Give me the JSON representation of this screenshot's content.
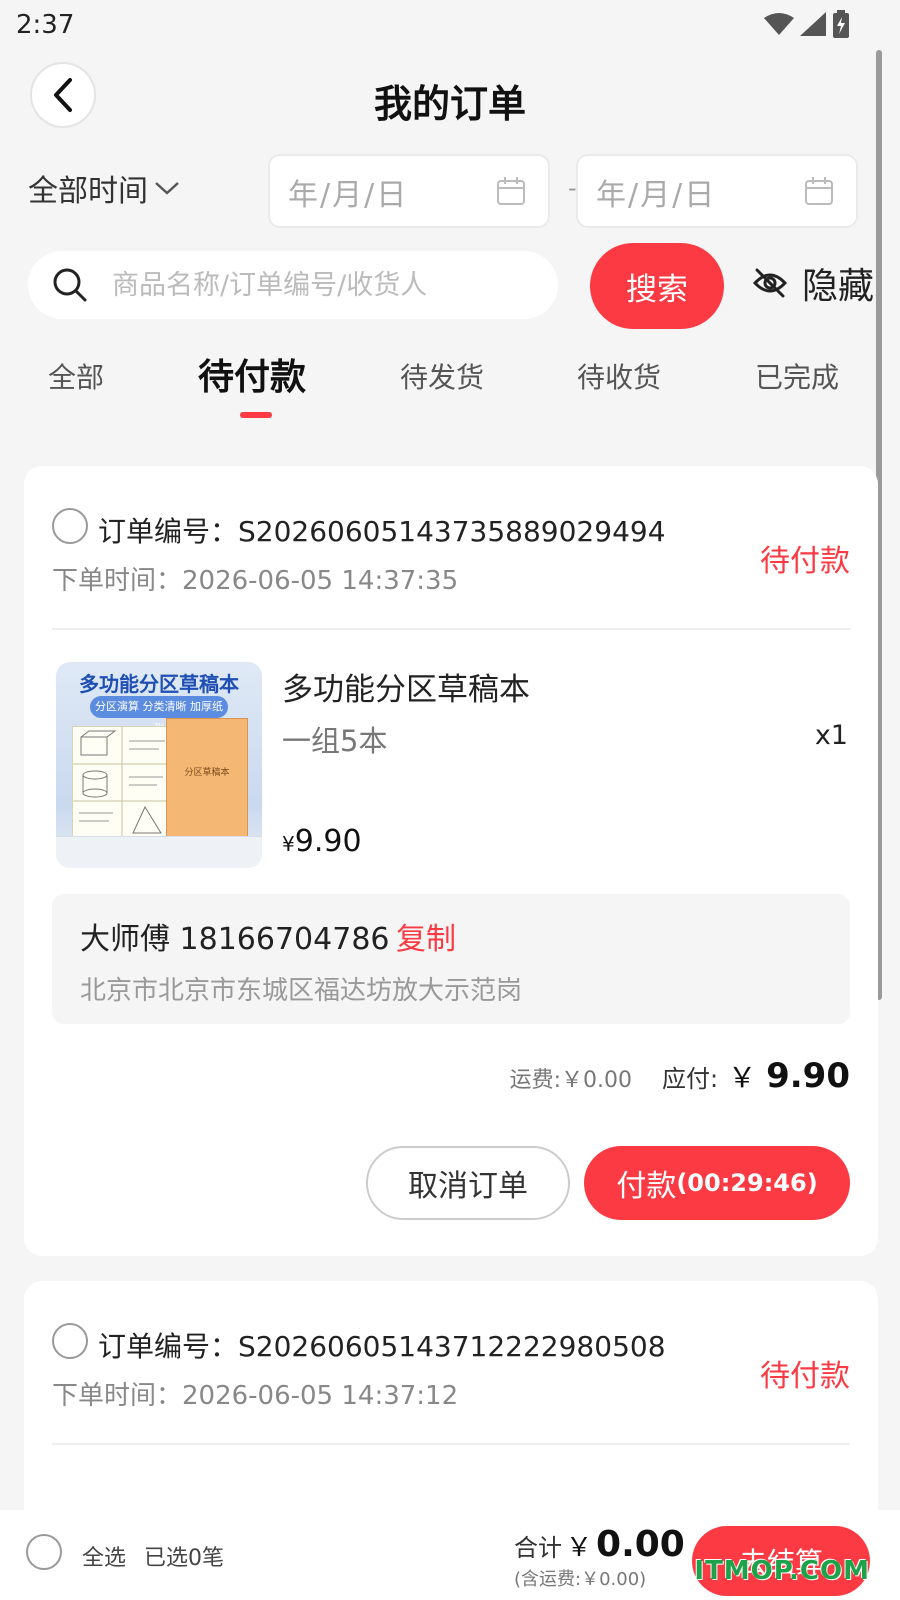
{
  "status_bar": {
    "time": "2:37"
  },
  "header": {
    "title": "我的订单"
  },
  "filters": {
    "time_range": "全部时间",
    "start_date_placeholder": "年/月/日",
    "end_date_placeholder": "年/月/日",
    "separator": "-"
  },
  "search": {
    "placeholder": "商品名称/订单编号/收货人",
    "button_label": "搜索",
    "hide_label": "隐藏"
  },
  "tabs": [
    {
      "label": "全部"
    },
    {
      "label": "待付款",
      "active": true
    },
    {
      "label": "待发货"
    },
    {
      "label": "待收货"
    },
    {
      "label": "已完成"
    }
  ],
  "orders": [
    {
      "number_label": "订单编号：S2026060514373588902949​4",
      "time_label": "下单时间：2026-06-05 14:37:35",
      "status": "待付款",
      "product": {
        "thumb_title": "多功能分区草稿本",
        "thumb_subtitle": "分区演算  分类清晰  加厚纸张",
        "thumb_book_label": "分区草稿本",
        "name": "多功能分区草稿本",
        "spec": "一组5本",
        "qty": "x1",
        "price_symbol": "¥",
        "price": "9.90"
      },
      "receiver": "大师傅 18166704786",
      "copy_label": "复制",
      "address": "北京市北京市东城区福达坊放大示范岗",
      "shipping": "运费:￥0.00",
      "payable_label": "应付:",
      "payable_symbol": "￥",
      "payable_amount": "9.90",
      "cancel_label": "取消订单",
      "pay_label": "付款",
      "pay_timer": "(00:29:46)"
    },
    {
      "number_label": "订单编号：S2026060514371222298050​8",
      "time_label": "下单时间：2026-06-05 14:37:12",
      "status": "待付款"
    }
  ],
  "bottom_bar": {
    "select_all": "全选",
    "selected_count": "已选0笔",
    "total_label": "合计",
    "total_symbol": "￥",
    "total_amount": "0.00",
    "total_note": "(含运费:￥0.00)",
    "checkout_label": "去结算"
  },
  "watermark": "ITMOP.COM",
  "colors": {
    "accent": "#fb3a43",
    "background": "#f5f5f5"
  }
}
